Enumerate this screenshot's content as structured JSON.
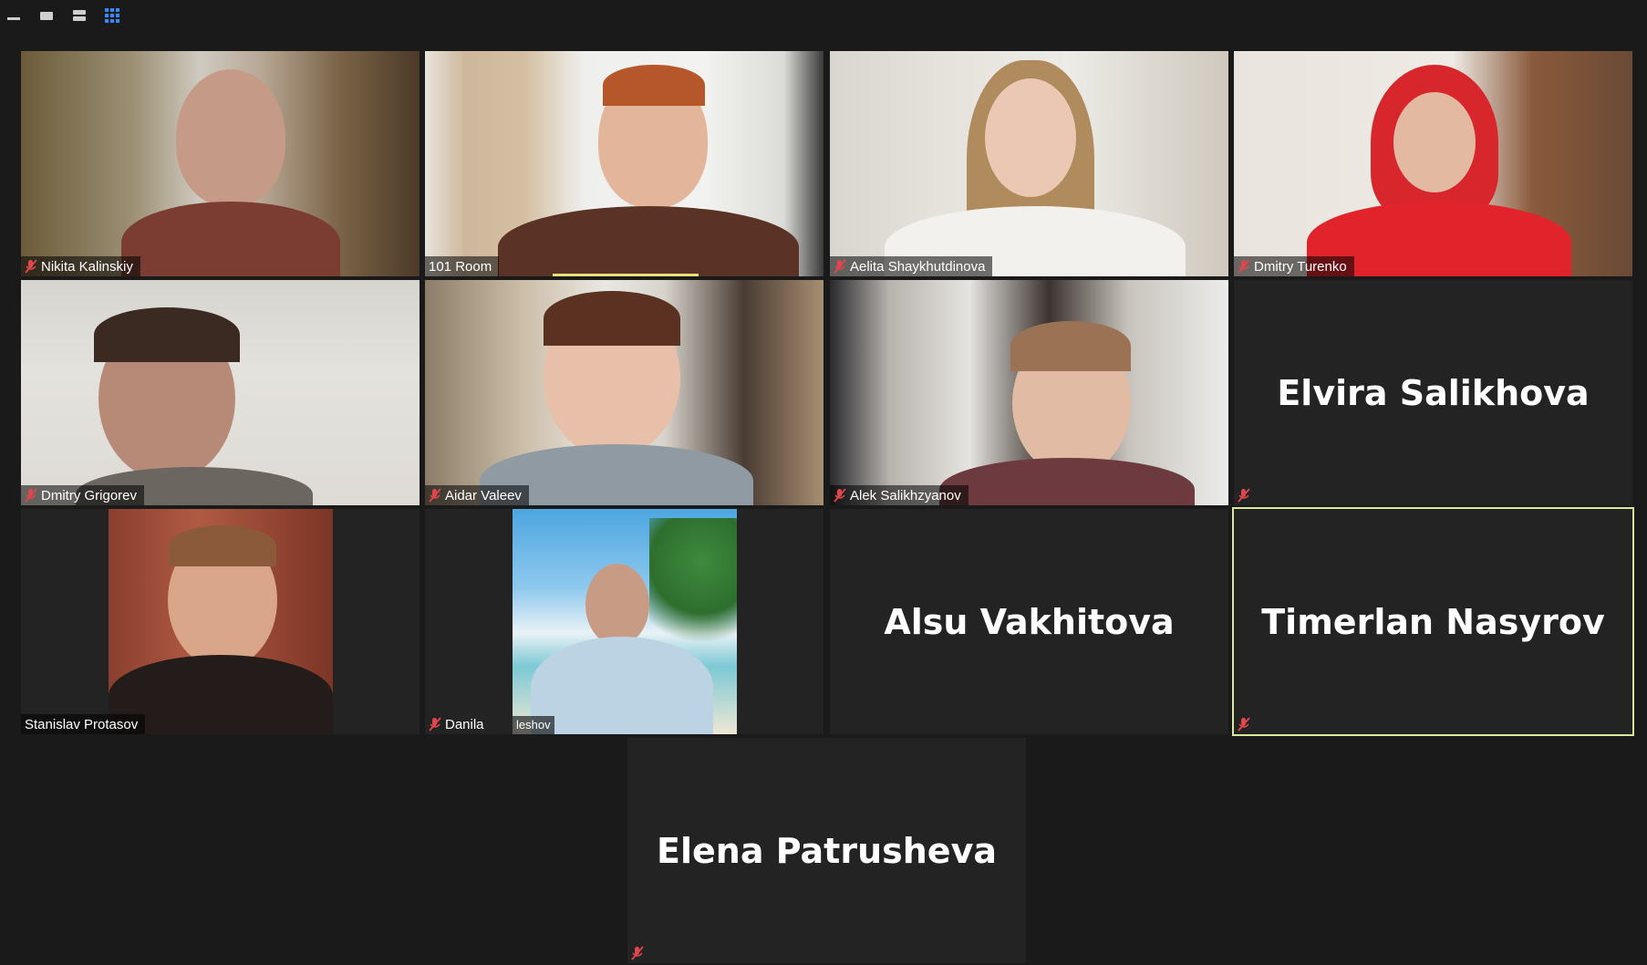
{
  "toolbar": {
    "views": [
      {
        "icon": "minimize-view-icon"
      },
      {
        "icon": "small-view-icon"
      },
      {
        "icon": "strip-view-icon"
      },
      {
        "icon": "gallery-view-icon",
        "active": true
      }
    ]
  },
  "participants": [
    {
      "name": "Nikita Kalinskiy",
      "video": true,
      "muted": true
    },
    {
      "name": "101 Room",
      "video": true,
      "muted": false,
      "speaking": true
    },
    {
      "name": "Aelita Shaykhutdinova",
      "video": true,
      "muted": true
    },
    {
      "name": "Dmitry Turenko",
      "video": true,
      "muted": true
    },
    {
      "name": "Dmitry Grigorev",
      "video": true,
      "muted": true
    },
    {
      "name": "Aidar Valeev",
      "video": true,
      "muted": true
    },
    {
      "name": "Alek Salikhzyanov",
      "video": true,
      "muted": true
    },
    {
      "name": "Elvira Salikhova",
      "video": false,
      "muted": true
    },
    {
      "name": "Stanislav Protasov",
      "video": true,
      "muted": false
    },
    {
      "name": "Danila",
      "video": true,
      "muted": true,
      "overlay_text": "leshov"
    },
    {
      "name": "Alsu Vakhitova",
      "video": false,
      "muted": false
    },
    {
      "name": "Timerlan Nasyrov",
      "video": false,
      "muted": true,
      "active": true
    },
    {
      "name": "Elena Patrusheva",
      "video": false,
      "muted": true
    }
  ],
  "colors": {
    "background": "#1a1a1a",
    "tile": "#232323",
    "active_border": "#d8e89a",
    "muted_icon": "#e0474c",
    "speaking_bar": "#e9e07a",
    "toolbar_active": "#2d8cff"
  }
}
